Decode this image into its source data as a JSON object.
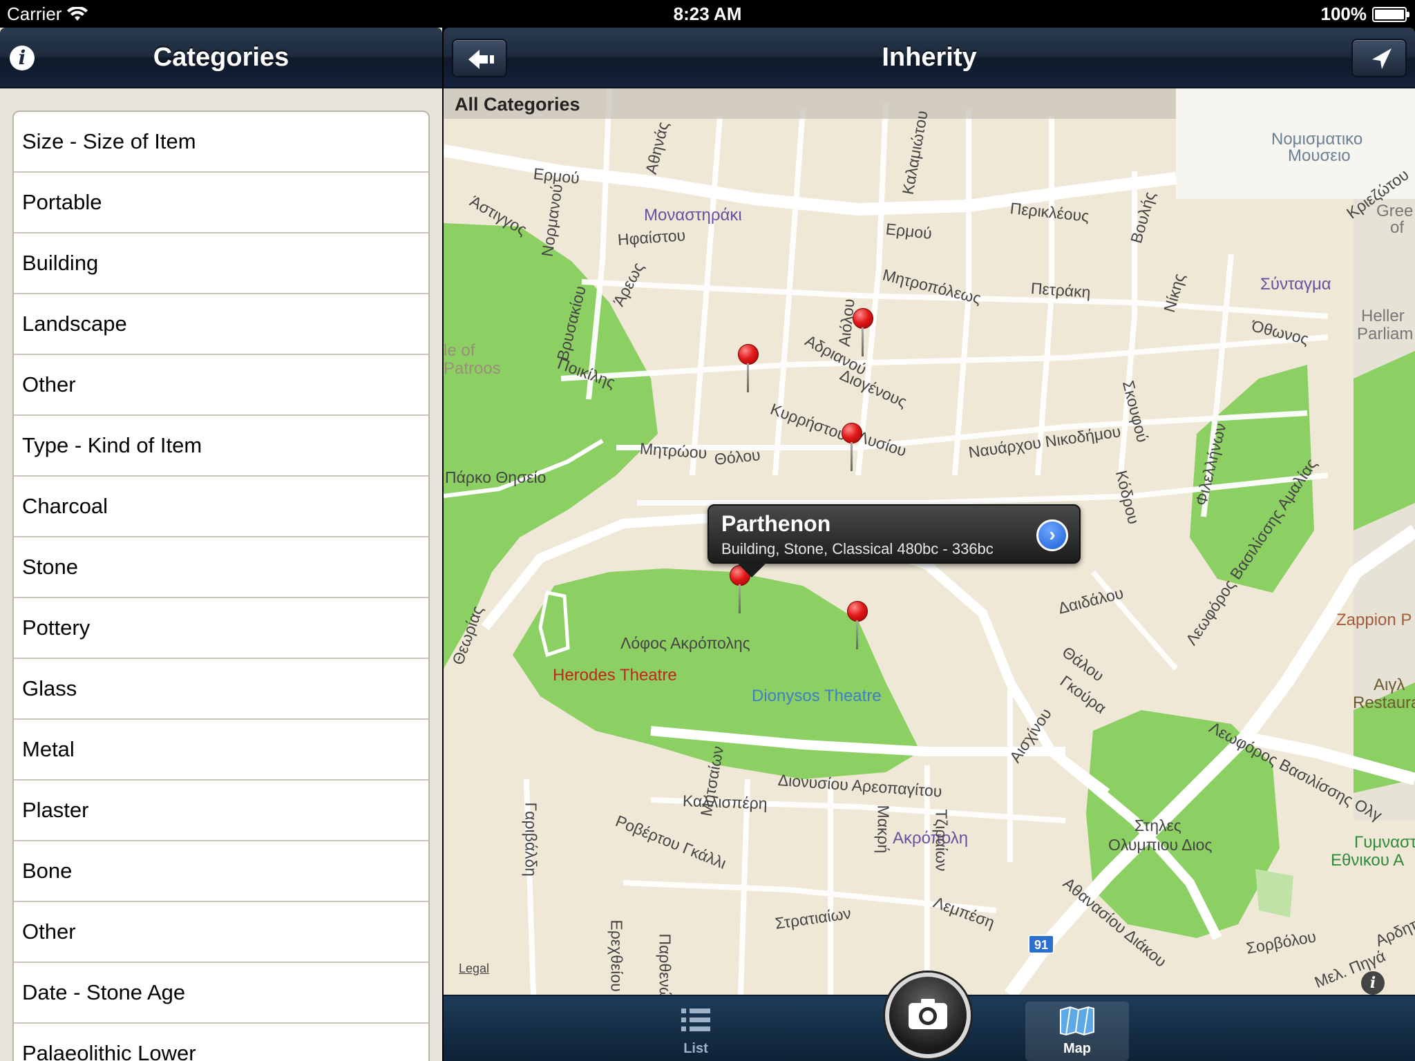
{
  "status_bar": {
    "carrier": "Carrier",
    "time": "8:23 AM",
    "battery": "100%"
  },
  "left_panel": {
    "title": "Categories",
    "items": [
      "Size - Size of Item",
      "Portable",
      "Building",
      "Landscape",
      "Other",
      "Type - Kind of Item",
      "Charcoal",
      "Stone",
      "Pottery",
      "Glass",
      "Metal",
      "Plaster",
      "Bone",
      "Other",
      "Date - Stone Age",
      "Palaeolithic Lower"
    ]
  },
  "right_panel": {
    "title": "Inherity",
    "filter_label": "All Categories",
    "callout": {
      "title": "Parthenon",
      "subtitle": "Building, Stone, Classical 480bc - 336bc"
    },
    "legal": "Legal",
    "route_number": "91",
    "places": {
      "monastiraki": "Μοναστηράκι",
      "herodes": "Herodes Theatre",
      "dionysos": "Dionysos Theatre",
      "acropolis_hill": "Λόφος Ακρόπολης",
      "akropoli": "Ακρόπολη",
      "syntagma": "Σύνταγμα",
      "zappion": "Zappion P",
      "stiles": "Στηλες",
      "olympiou": "Ολυμπιου Διος",
      "parko": "Πάρκο Θησείο",
      "numismatic1": "Νομισματικο",
      "numismatic2": "Μουσειο",
      "hellenic1": "Heller",
      "hellenic2": "Parliam",
      "greek1": "Gree",
      "greek2": "of",
      "gymnastirio1": "Γυμναστ",
      "gymnastirio2": "Εθνικου Α",
      "aigli1": "Αιγλ",
      "aigli2": "Restauran",
      "patroos1": "le of",
      "patroos2": "Patroos"
    },
    "streets": {
      "ermou1": "Ερμού",
      "ermou2": "Ερμού",
      "astiggos": "Άστιγγος",
      "ifaistou": "Ηφαίστου",
      "mitropoleos": "Μητροπόλεως",
      "periklous": "Περικλέους",
      "petraki": "Πετράκη",
      "othonos": "Όθωνος",
      "adrianou": "Αδριανού",
      "diogenous": "Διογένους",
      "kyrristou": "Κυρρήστου",
      "lysiou": "Λυσίου",
      "poikilis": "Ποικίλης",
      "mitroou": "Μητρώου",
      "tholou": "Θόλου",
      "navarchou": "Ναυάρχου Νικοδήμου",
      "dionysiou": "Διονυσίου Αρεοπαγίτου",
      "kallisperi": "Καλλισπέρη",
      "robertou": "Ροβέρτου Γκάλλι",
      "strataion": "Στρατιαίων",
      "lempesi": "Λεμπέση",
      "athanasiou": "Αθανασίου Διάκου",
      "sorvolou": "Σορβόλου",
      "vasilissis1": "Λεωφόρος Βασιλίσσης Αμαλίας",
      "vasilissis2": "Λεωφόρος Βασιλίσσης Ολγ",
      "daidalou": "Δαιδάλου",
      "thalou": "Θάλου",
      "gkoura": "Γκούρα",
      "aischinou": "Αισχίνου",
      "garivaldi": "Γαριβάλδη",
      "erechtheiou": "Ερεχθείου",
      "parthenonos": "Παρθενώνος",
      "mitseon": "Μητσαίων",
      "makri": "Μακρή",
      "tziraion": "Τζιραίων",
      "theorias": "Θεωρίας",
      "kriezotou": "Κριεζώτου",
      "voulis": "Βουλής",
      "nikis": "Νίκης",
      "filellinon": "Φιλελλήνων",
      "kodrou": "Κόδρου",
      "skoufou": "Σκουφού",
      "kalamiotou": "Καλαμιώτου",
      "aiolou": "Αιόλου",
      "areos": "Άρεως",
      "normanou": "Νορμανού",
      "vrysakiou": "Βρυσακίου",
      "athinas": "Αθηνάς",
      "ardittou": "Αρδηττ",
      "mel_piga": "Μελ. Πηγά"
    }
  },
  "tab_bar": {
    "list_label": "List",
    "map_label": "Map"
  }
}
